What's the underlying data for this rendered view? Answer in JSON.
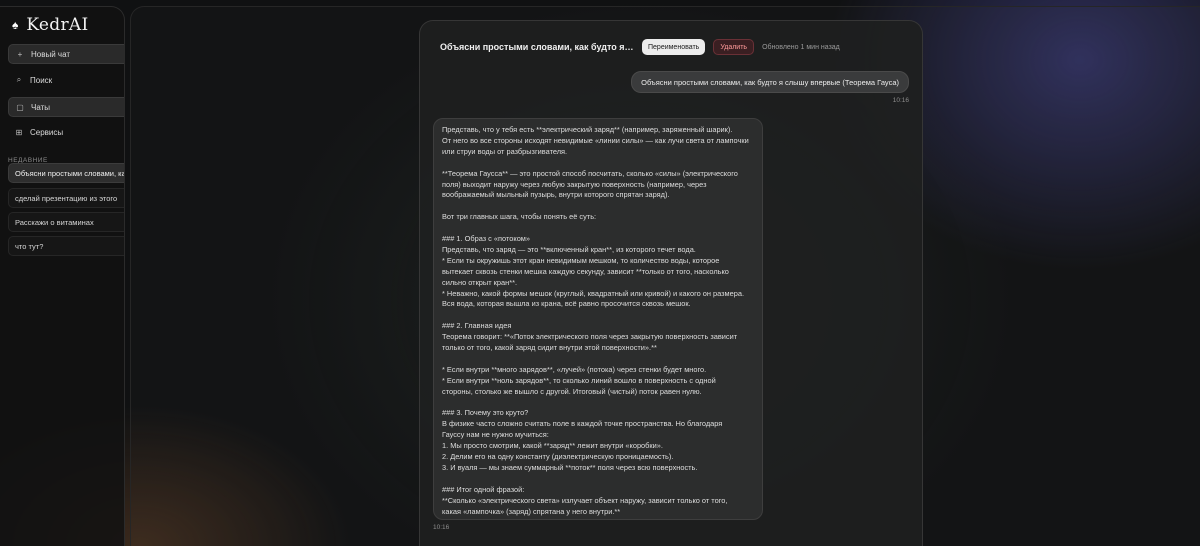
{
  "sidebar": {
    "brand": "KedrAI",
    "nav": [
      {
        "label": "Новый чат",
        "icon": "+"
      },
      {
        "label": "Поиск",
        "icon": "⌕"
      },
      {
        "label": "Чаты",
        "icon": "▢"
      },
      {
        "label": "Сервисы",
        "icon": "⊞"
      }
    ],
    "recent_label": "НЕДАВНИЕ",
    "recent": [
      "Объясни простыми словами, как будто я слышу впервые (Теорема Гауса)",
      "сделай презентацию из этого",
      "Расскажи о витаминах",
      "что тут?"
    ]
  },
  "chat": {
    "title": "Объясни простыми словами, как будто я слышу впервые (Теорема Гауса)",
    "rename_label": "Переименовать",
    "delete_label": "Удалить",
    "updated": "Обновлено 1 мин назад",
    "user_message": "Объясни простыми словами, как будто я слышу впервые (Теорема Гауса)",
    "user_time": "10:16",
    "ai_lines": [
      "Представь, что у тебя есть **электрический заряд** (например, заряженный шарик).",
      "От него во все стороны исходят невидимые «линии силы» — как лучи света от лампочки",
      "или струи воды от разбрызгивателя.",
      "",
      "**Теорема Гаусса** — это простой способ посчитать, сколько «силы» (электрического",
      "поля) выходит наружу через любую закрытую поверхность (например, через",
      "воображаемый мыльный пузырь, внутри которого спрятан заряд).",
      "",
      "Вот три главных шага, чтобы понять её суть:",
      "",
      "### 1. Образ с «потоком»",
      "Представь, что заряд — это **включенный кран**, из которого течет вода.",
      "*   Если ты окружишь этот кран невидимым мешком, то количество воды, которое",
      "вытекает сквозь стенки мешка каждую секунду, зависит **только от того, насколько",
      "сильно открыт кран**.",
      "*   Неважно, какой формы мешок (круглый, квадратный или кривой) и какого он размера.",
      "Вся вода, которая вышла из крана, всё равно просочится сквозь мешок.",
      "",
      "### 2. Главная идея",
      "Теорема говорит: **«Поток электрического поля через закрытую поверхность зависит",
      "только от того, какой заряд сидит внутри этой поверхности».**",
      "",
      "*   Если внутри **много зарядов**, «лучей» (потока) через стенки будет много.",
      "*   Если внутри **ноль зарядов**, то сколько линий вошло в поверхность с одной",
      "стороны, столько же вышло с другой. Итоговый (чистый) поток равен нулю.",
      "",
      "### 3. Почему это круто?",
      "В физике часто сложно считать поле в каждой точке пространства. Но благодаря",
      "Гауссу нам не нужно мучиться:",
      "1. Мы просто смотрим, какой **заряд** лежит внутри «коробки».",
      "2. Делим его на одну константу (диэлектрическую проницаемость).",
      "3. И вуаля — мы знаем суммарный **поток** поля через всю поверхность.",
      "",
      "### Итог одной фразой:",
      "**Сколько «электрического света» излучает объект наружу, зависит только от того,",
      "какая «лампочка» (заряд) спрятана у него внутри.**"
    ],
    "ai_time": "10:16"
  }
}
